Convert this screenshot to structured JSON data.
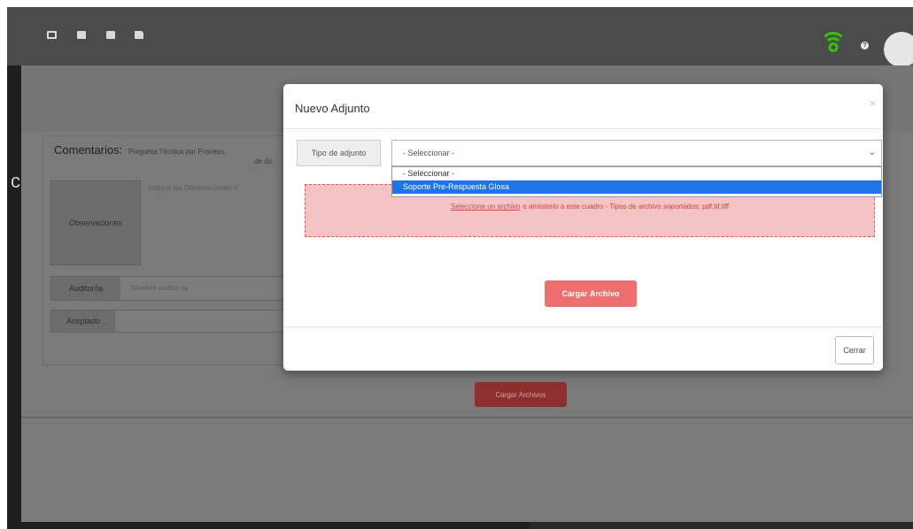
{
  "page": {
    "side_label": "c",
    "comentarios": {
      "title": "Comentarios:",
      "subtitle": "Pregunta Técnica por Proceso,",
      "subtitle2": "de dú"
    },
    "observaciones": {
      "label": "Observaciones",
      "placeholder": "Indique las Observaciones ri"
    },
    "auditor": {
      "label": "Auditor/ia",
      "placeholder": "Nombre auditor ia"
    },
    "aceptado": {
      "label": "Aceptado"
    },
    "upload_button": "Cargar Archivos"
  },
  "modal": {
    "title": "Nuevo Adjunto",
    "close": "×",
    "tipo_label": "Tipo de adjunto",
    "select_value": "- Seleccionar -",
    "options": [
      "- Seleccionar -",
      "Soporte Pre-Respuesta Glosa"
    ],
    "selected_option_index": 1,
    "dropzone": {
      "link_text": "Seleccione un archivo",
      "text": "o arrástrelo a este cuadro - Tipos de archivo soportados: pdf,tif,tiff"
    },
    "upload_button": "Cargar Archivo",
    "close_button": "Cerrar"
  },
  "colors": {
    "topbar": "#4b4b4b",
    "wifi": "#34c400",
    "dropzone_bg": "#f4c4c4",
    "dropzone_text": "#d04040",
    "upload_button": "#ee6f6f",
    "selected_option": "#1e73e8"
  },
  "icons": [
    "inbox-icon",
    "card-icon",
    "calendar-icon",
    "folder-icon",
    "wifi-icon",
    "help-icon",
    "avatar"
  ]
}
